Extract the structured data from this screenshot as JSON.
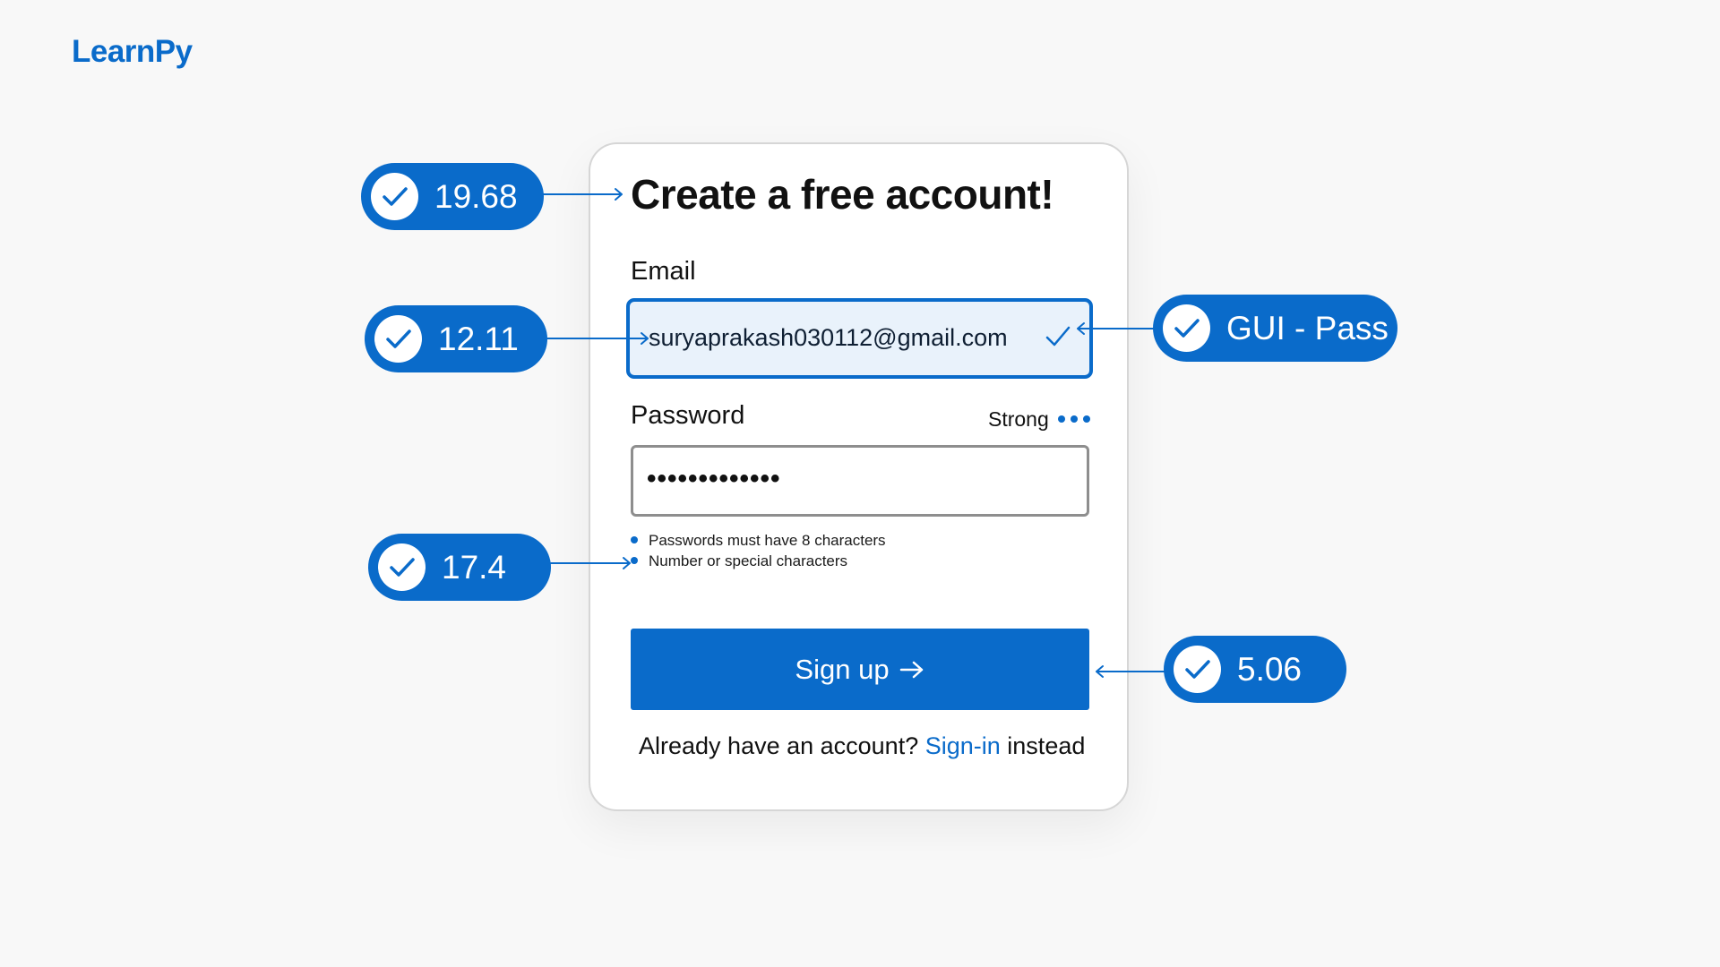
{
  "brand": {
    "name": "LearnPy"
  },
  "form": {
    "title": "Create a free account!",
    "email_label": "Email",
    "email_value": "suryaprakash030112@gmail.com",
    "password_label": "Password",
    "password_strength": "Strong",
    "password_value": "•••••••••••••",
    "hints": [
      "Passwords must have 8 characters",
      "Number or special characters"
    ],
    "signup_label": "Sign up",
    "footer_prefix": "Already have an account?",
    "footer_link": "Sign-in",
    "footer_suffix": "instead"
  },
  "annotations": {
    "title": "19.68",
    "email": "12.11",
    "hints": "17.4",
    "status": "GUI - Pass",
    "button": "5.06"
  },
  "colors": {
    "accent": "#0a6bca",
    "background": "#f8f8f8",
    "email_field_bg": "#e9f2fb"
  },
  "icons": {
    "annotation": "check-circle-icon",
    "email_valid": "check-icon",
    "strength": "dots-icon",
    "signup": "arrow-right-icon"
  }
}
